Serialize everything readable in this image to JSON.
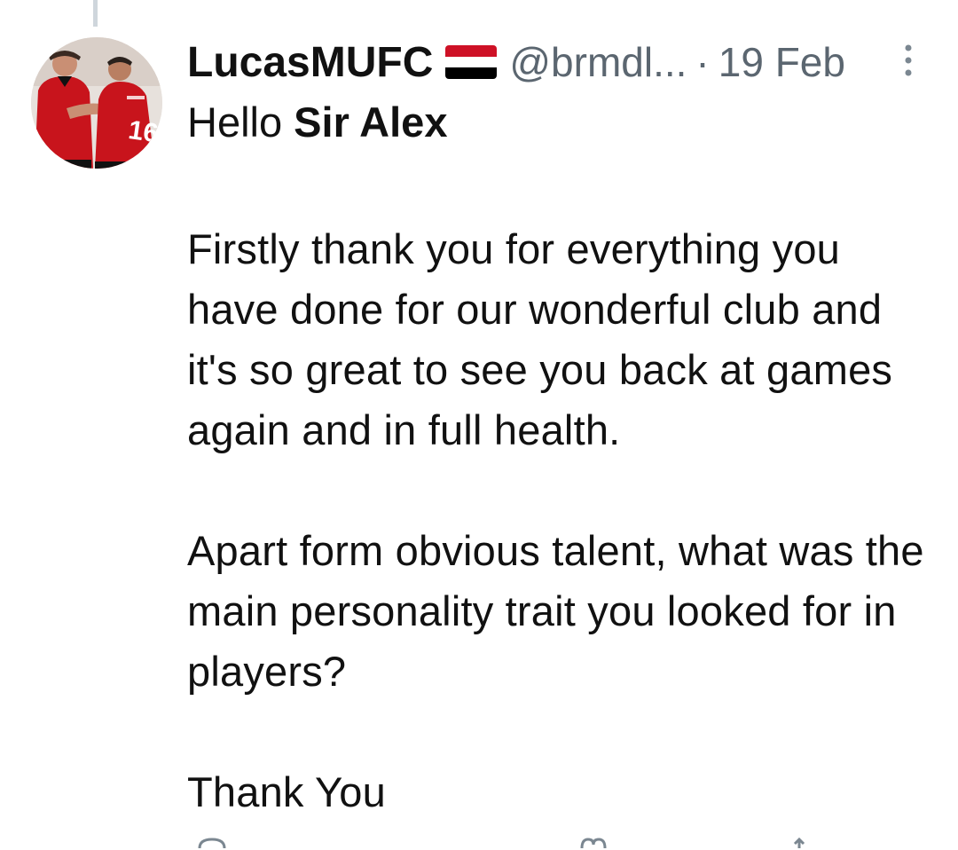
{
  "tweet": {
    "display_name": "LucasMUFC",
    "flag_icon": "yemen-flag-icon",
    "handle": "@brmdl...",
    "separator": "·",
    "date": "19 Feb",
    "greeting_prefix": "Hello ",
    "greeting_bold": "Sir Alex",
    "paragraphs": [
      "Firstly thank you for everything you have done for our wonderful club and it's so great to see you back at games again and in full health.",
      "Apart form obvious talent, what was the main personality trait you looked for in players?",
      "Thank You"
    ]
  },
  "icons": {
    "more": "more-vertical-icon",
    "reply": "reply-icon",
    "like": "like-icon",
    "share": "share-icon"
  },
  "colors": {
    "text": "#111111",
    "muted": "#5b6670",
    "thread_line": "#cfd6dc",
    "flag_red": "#ce1126",
    "flag_white": "#ffffff",
    "flag_black": "#000000"
  }
}
